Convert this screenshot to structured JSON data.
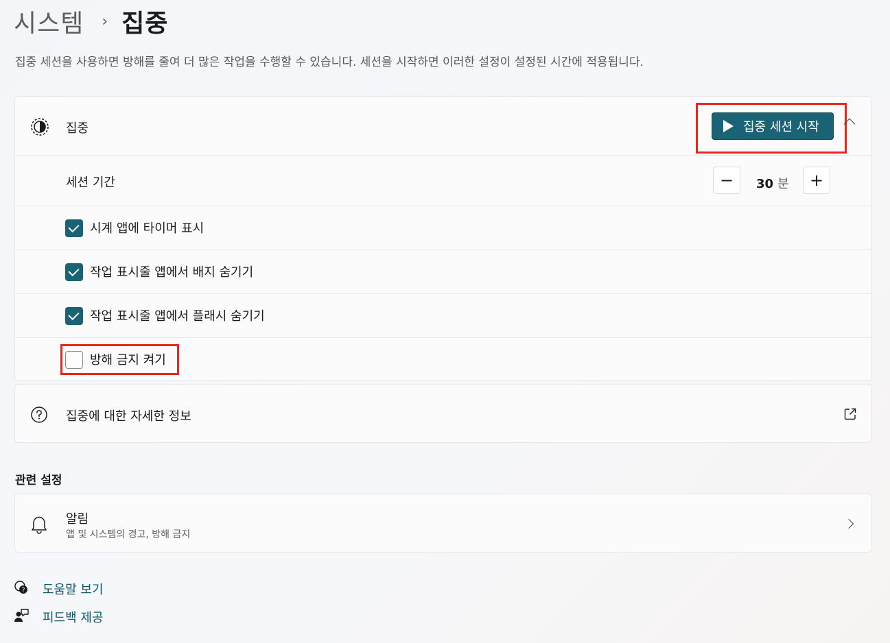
{
  "breadcrumb": {
    "parent": "시스템",
    "separator": "›",
    "current": "집중"
  },
  "description": "집중 세션을 사용하면 방해를 줄여 더 많은 작업을 수행할 수 있습니다. 세션을 시작하면 이러한 설정이 설정된 시간에 적용됩니다.",
  "focus_card": {
    "title": "집중",
    "icon": "focus-timer-icon",
    "start_button": "집중 세션 시작",
    "session": {
      "label": "세션 기간",
      "minus": "−",
      "value": "30",
      "unit": "분",
      "plus": "+"
    },
    "options": [
      {
        "label": "시계 앱에 타이머 표시",
        "checked": true
      },
      {
        "label": "작업 표시줄 앱에서 배지 숨기기",
        "checked": true
      },
      {
        "label": "작업 표시줄 앱에서 플래시 숨기기",
        "checked": true
      },
      {
        "label": "방해 금지 켜기",
        "checked": false
      }
    ]
  },
  "info_card": {
    "label": "집중에 대한 자세한 정보",
    "icon": "help-circle-icon"
  },
  "related": {
    "title": "관련 설정",
    "notifications": {
      "title": "알림",
      "subtitle": "앱 및 시스템의 경고, 방해 금지",
      "icon": "bell-icon"
    }
  },
  "links": [
    {
      "label": "도움말 보기",
      "icon": "help-search-icon"
    },
    {
      "label": "피드백 제공",
      "icon": "feedback-icon"
    }
  ],
  "colors": {
    "accent": "#1a6374",
    "highlight": "#e8281c",
    "link": "#0e5a6b"
  }
}
